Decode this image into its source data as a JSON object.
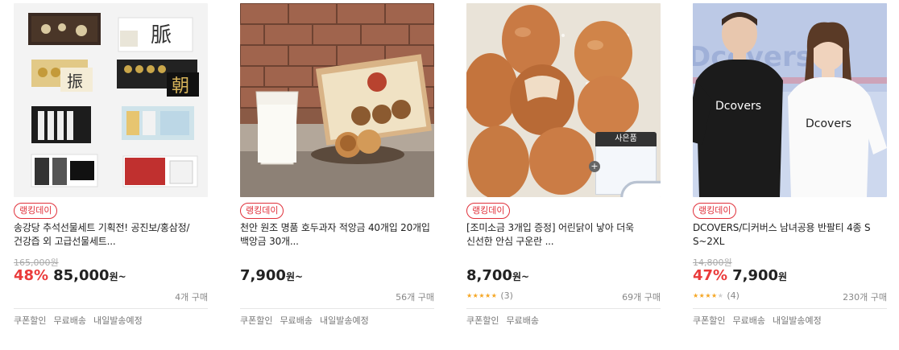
{
  "cards": [
    {
      "badge": "랭킹데이",
      "title": "송강당 추석선물세트 기획전! 공진보/홍삼정/건강즙 외 고급선물세트...",
      "original_price": "165,000원",
      "discount": "48%",
      "price": "85,000",
      "currency": "원",
      "price_suffix": "~",
      "purchases": "4개 구매",
      "tags": [
        "쿠폰할인",
        "무료배송",
        "내일발송예정"
      ]
    },
    {
      "badge": "랭킹데이",
      "title": "천안 원조 명품 호두과자 적앙금 40개입 20개입 백앙금 30개...",
      "price": "7,900",
      "currency": "원",
      "price_suffix": "~",
      "purchases": "56개 구매",
      "tags": [
        "쿠폰할인",
        "무료배송",
        "내일발송예정"
      ]
    },
    {
      "badge": "랭킹데이",
      "title": "[조미소금 3개입 증정] 어린닭이 낳아 더욱 신선한 안심 구운란 ...",
      "price": "8,700",
      "currency": "원",
      "price_suffix": "~",
      "rating_count": "(3)",
      "rating_stars": 5,
      "purchases": "69개 구매",
      "gift_label": "사은품",
      "tags": [
        "쿠폰할인",
        "무료배송"
      ]
    },
    {
      "badge": "랭킹데이",
      "title": "DCOVERS/디커버스 남녀공용 반팔티 4종 S S~2XL",
      "original_price": "14,800원",
      "discount": "47%",
      "price": "7,900",
      "currency": "원",
      "rating_count": "(4)",
      "rating_stars": 4,
      "purchases": "230개 구매",
      "tags": [
        "쿠폰할인",
        "무료배송",
        "내일발송예정"
      ]
    }
  ]
}
